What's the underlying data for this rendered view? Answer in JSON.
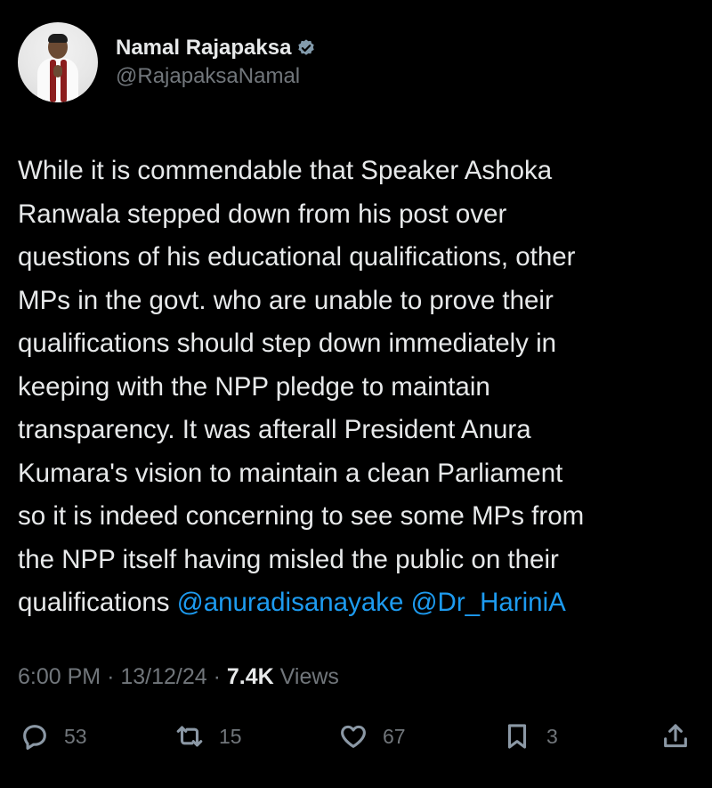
{
  "author": {
    "name": "Namal Rajapaksa",
    "handle": "@RajapaksaNamal",
    "verified": true
  },
  "tweet": {
    "lines": [
      "While it is commendable that Speaker Ashoka",
      "Ranwala stepped down from his post over",
      "questions of his educational qualifications, other",
      "MPs in the govt. who are unable to prove their",
      "qualifications should step down immediately in",
      "keeping with the NPP pledge to maintain",
      "transparency. It was afterall President Anura",
      "Kumara's vision to maintain a clean Parliament",
      "so it is indeed concerning to see some MPs from",
      "the NPP itself having misled the public on their"
    ],
    "last_line_text": "qualifications",
    "mentions": [
      "@anuradisanayake",
      "@Dr_HariniA"
    ]
  },
  "meta": {
    "time": "6:00 PM",
    "date": "13/12/24",
    "views_count": "7.4K",
    "views_label": "Views",
    "separator": "·"
  },
  "actions": {
    "replies": "53",
    "reposts": "15",
    "likes": "67",
    "bookmarks": "3"
  },
  "icons": {
    "verified": "verified-badge-icon",
    "reply": "reply-icon",
    "repost": "repost-icon",
    "like": "heart-icon",
    "bookmark": "bookmark-icon",
    "share": "share-icon"
  },
  "colors": {
    "background": "#000000",
    "text": "#e7e9ea",
    "muted": "#71767b",
    "link": "#1d9bf0"
  }
}
